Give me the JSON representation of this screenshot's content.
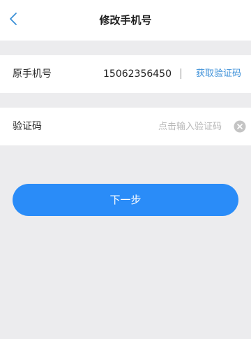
{
  "header": {
    "title": "修改手机号",
    "back_icon": "chevron-left-icon"
  },
  "original_phone": {
    "label": "原手机号",
    "value": "15062356450",
    "get_code_label": "获取验证码"
  },
  "verification": {
    "label": "验证码",
    "placeholder": "点击输入验证码",
    "value": "",
    "clear_icon": "clear-icon"
  },
  "actions": {
    "next_label": "下一步"
  },
  "colors": {
    "accent": "#2a8cf8",
    "link": "#3b8fd8",
    "background": "#ececee"
  }
}
